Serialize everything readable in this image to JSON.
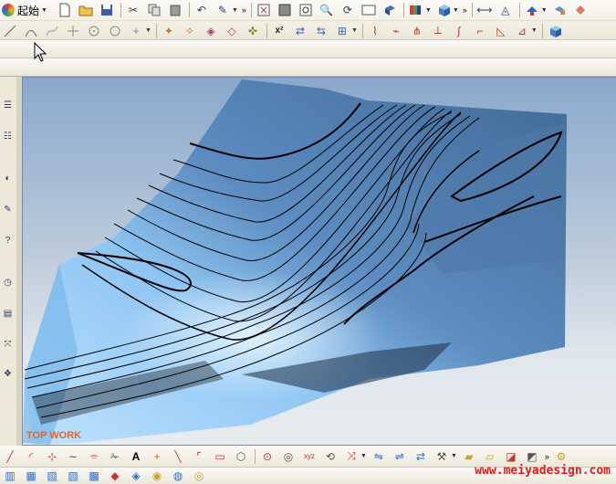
{
  "toolbar": {
    "start_label": "起始",
    "icons_row1": [
      "new-file",
      "open-folder",
      "save",
      "cut",
      "copy",
      "paste",
      "undo",
      "redo-menu",
      "fit-view",
      "shaded",
      "zoom-window",
      "zoom",
      "rotate",
      "view-box",
      "iso-view",
      "color-palette",
      "solid-box",
      "measure",
      "analysis",
      "render-shade",
      "shade-toggle"
    ],
    "icons_row2": [
      "line",
      "arc",
      "point",
      "circle",
      "plus",
      "feature-a",
      "feature-b",
      "feature-c",
      "feature-d",
      "feature-e",
      "x-squared",
      "transform-a",
      "transform-b",
      "transform-c",
      "curve-a",
      "curve-b",
      "curve-c",
      "curve-d",
      "curve-e",
      "corner",
      "curve-f",
      "solid-view"
    ]
  },
  "viewport": {
    "label": "TOP WORK",
    "sky_top": "#8aa8cc",
    "sky_bottom": "#e8ecef",
    "surface_light": "#9fd0f5",
    "surface_dark": "#3f6a96",
    "contour_color": "#000000"
  },
  "status": {
    "watermark": "www.meiyadesign.com"
  },
  "left_icons": [
    "layers-icon",
    "levels-icon",
    "shape-icon",
    "ruler-icon",
    "help-icon",
    "clock-icon",
    "document-icon",
    "transform-icon",
    "solids-icon"
  ]
}
